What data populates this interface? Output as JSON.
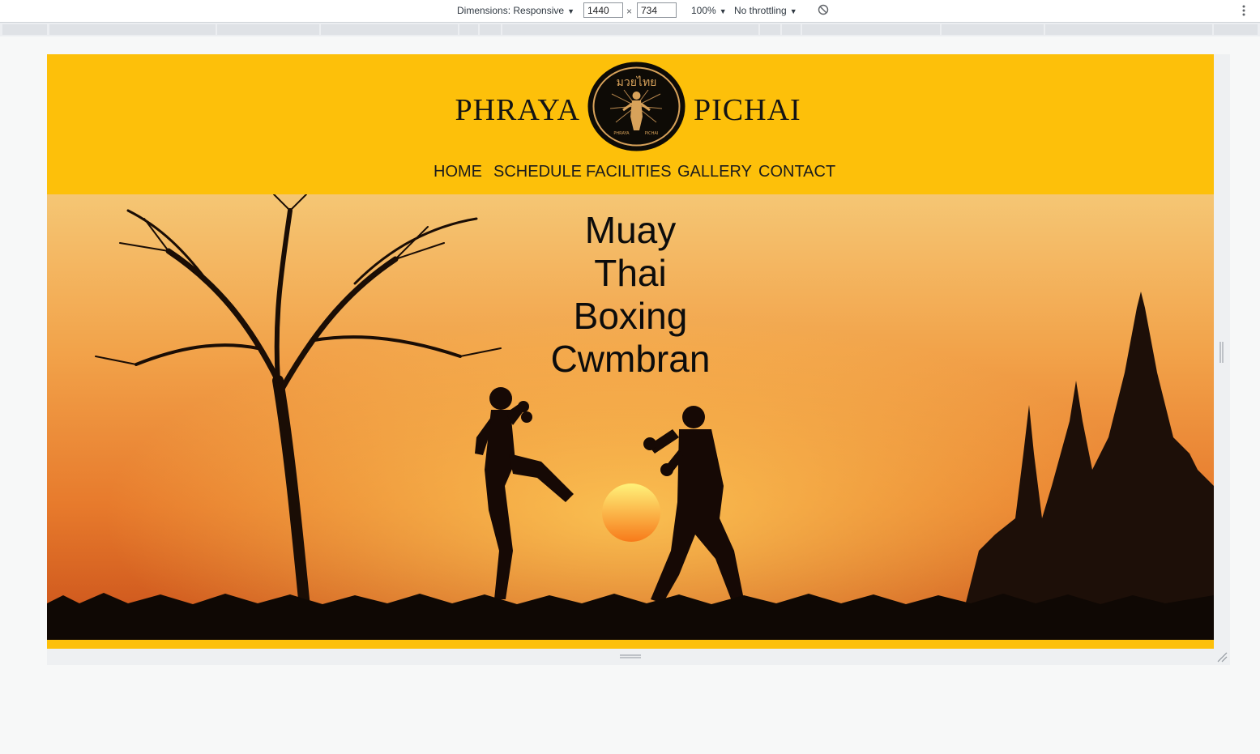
{
  "devtools": {
    "dimensions_label": "Dimensions: Responsive",
    "width_value": "1440",
    "times_sign": "×",
    "height_value": "734",
    "zoom": "100%",
    "throttling": "No throttling",
    "icons": [
      "rotate-icon",
      "more-options-icon"
    ]
  },
  "site": {
    "brand_left": "PHRAYA",
    "brand_right": "PICHAI",
    "logo": {
      "thai_text": "มวยไทย",
      "caption_left": "PHRAYA",
      "caption_right": "PICHAI"
    },
    "nav": [
      "HOME",
      "SCHEDULE",
      "FACILITIES",
      "GALLERY",
      "CONTACT"
    ],
    "hero": {
      "lines": [
        "Muay",
        "Thai",
        "Boxing",
        "Cwmbran"
      ]
    }
  },
  "colors": {
    "header": "#fdc00a",
    "text": "#141414",
    "sky_top": "#f4c06a",
    "sky_bottom": "#e06420"
  }
}
